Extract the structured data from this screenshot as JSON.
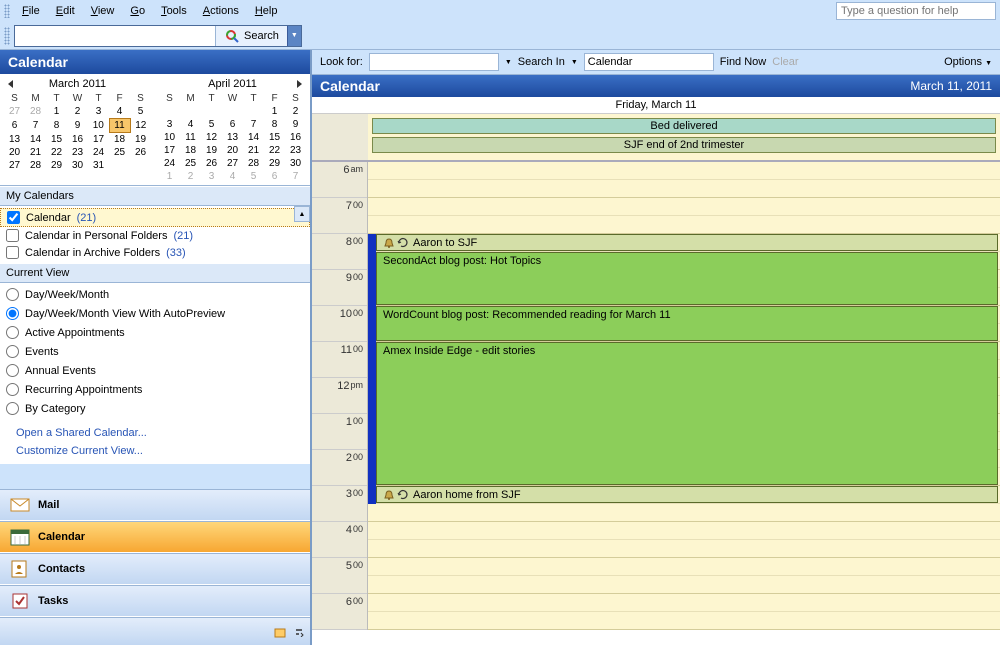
{
  "menu": {
    "file": "File",
    "edit": "Edit",
    "view": "View",
    "go": "Go",
    "tools": "Tools",
    "actions": "Actions",
    "help": "Help"
  },
  "help_placeholder": "Type a question for help",
  "search_button": "Search",
  "sidebar": {
    "title": "Calendar",
    "month1": {
      "label": "March 2011"
    },
    "month2": {
      "label": "April 2011"
    },
    "dow": [
      "S",
      "M",
      "T",
      "W",
      "T",
      "F",
      "S"
    ],
    "mycal_header": "My Calendars",
    "calendars": [
      {
        "label": "Calendar",
        "count": "(21)",
        "checked": true
      },
      {
        "label": "Calendar in Personal Folders",
        "count": "(21)",
        "checked": false
      },
      {
        "label": "Calendar in Archive Folders",
        "count": "(33)",
        "checked": false
      }
    ],
    "currentview_header": "Current View",
    "views": [
      "Day/Week/Month",
      "Day/Week/Month View With AutoPreview",
      "Active Appointments",
      "Events",
      "Annual Events",
      "Recurring Appointments",
      "By Category"
    ],
    "view_selected": 1,
    "links": [
      "Open a Shared Calendar...",
      "Customize Current View..."
    ],
    "nav": {
      "mail": "Mail",
      "calendar": "Calendar",
      "contacts": "Contacts",
      "tasks": "Tasks"
    }
  },
  "lookbar": {
    "lookfor_label": "Look for:",
    "searchin_label": "Search In",
    "searchin_value": "Calendar",
    "findnow": "Find Now",
    "clear": "Clear",
    "options": "Options"
  },
  "calendar": {
    "title": "Calendar",
    "date_long": "March 11, 2011",
    "day_header": "Friday, March 11",
    "allday": [
      "Bed delivered",
      "SJF end of 2nd trimester"
    ],
    "hours": [
      {
        "h": "6",
        "m": "am"
      },
      {
        "h": "7",
        "m": "00"
      },
      {
        "h": "8",
        "m": "00"
      },
      {
        "h": "9",
        "m": "00"
      },
      {
        "h": "10",
        "m": "00"
      },
      {
        "h": "11",
        "m": "00"
      },
      {
        "h": "12",
        "m": "pm"
      },
      {
        "h": "1",
        "m": "00"
      },
      {
        "h": "2",
        "m": "00"
      },
      {
        "h": "3",
        "m": "00"
      },
      {
        "h": "4",
        "m": "00"
      },
      {
        "h": "5",
        "m": "00"
      },
      {
        "h": "6",
        "m": "00"
      }
    ],
    "appts": [
      {
        "label": "Aaron to SJF",
        "start": 2,
        "dur": 0.5,
        "type": "recur",
        "busy": true
      },
      {
        "label": "SecondAct blog post: Hot Topics",
        "start": 2.5,
        "dur": 1.5,
        "type": "green",
        "busy": true
      },
      {
        "label": "WordCount blog post: Recommended reading for March 11",
        "start": 4,
        "dur": 1,
        "type": "green",
        "busy": true
      },
      {
        "label": "Amex Inside Edge - edit stories",
        "start": 5,
        "dur": 4,
        "type": "green",
        "busy": true
      },
      {
        "label": "Aaron home from SJF",
        "start": 9,
        "dur": 0.5,
        "type": "recur",
        "busy": true
      }
    ]
  },
  "march_days": [
    [
      {
        "d": 27,
        "o": 1
      },
      {
        "d": 28,
        "o": 1
      },
      {
        "d": 1
      },
      {
        "d": 2
      },
      {
        "d": 3
      },
      {
        "d": 4
      },
      {
        "d": 5
      }
    ],
    [
      {
        "d": 6
      },
      {
        "d": 7
      },
      {
        "d": 8
      },
      {
        "d": 9
      },
      {
        "d": 10
      },
      {
        "d": 11,
        "t": 1
      },
      {
        "d": 12
      }
    ],
    [
      {
        "d": 13
      },
      {
        "d": 14
      },
      {
        "d": 15
      },
      {
        "d": 16
      },
      {
        "d": 17
      },
      {
        "d": 18
      },
      {
        "d": 19
      }
    ],
    [
      {
        "d": 20
      },
      {
        "d": 21
      },
      {
        "d": 22
      },
      {
        "d": 23
      },
      {
        "d": 24
      },
      {
        "d": 25
      },
      {
        "d": 26
      }
    ],
    [
      {
        "d": 27
      },
      {
        "d": 28
      },
      {
        "d": 29
      },
      {
        "d": 30
      },
      {
        "d": 31
      },
      {
        "d": "",
        "o": 1
      },
      {
        "d": "",
        "o": 1
      }
    ]
  ],
  "april_days": [
    [
      {
        "d": "",
        "o": 1
      },
      {
        "d": "",
        "o": 1
      },
      {
        "d": "",
        "o": 1
      },
      {
        "d": "",
        "o": 1
      },
      {
        "d": "",
        "o": 1
      },
      {
        "d": 1
      },
      {
        "d": 2
      }
    ],
    [
      {
        "d": 3
      },
      {
        "d": 4
      },
      {
        "d": 5
      },
      {
        "d": 6
      },
      {
        "d": 7
      },
      {
        "d": 8
      },
      {
        "d": 9
      }
    ],
    [
      {
        "d": 10
      },
      {
        "d": 11
      },
      {
        "d": 12
      },
      {
        "d": 13
      },
      {
        "d": 14
      },
      {
        "d": 15
      },
      {
        "d": 16
      }
    ],
    [
      {
        "d": 17
      },
      {
        "d": 18
      },
      {
        "d": 19
      },
      {
        "d": 20
      },
      {
        "d": 21
      },
      {
        "d": 22
      },
      {
        "d": 23
      }
    ],
    [
      {
        "d": 24
      },
      {
        "d": 25
      },
      {
        "d": 26
      },
      {
        "d": 27
      },
      {
        "d": 28
      },
      {
        "d": 29
      },
      {
        "d": 30
      }
    ],
    [
      {
        "d": 1,
        "o": 1
      },
      {
        "d": 2,
        "o": 1
      },
      {
        "d": 3,
        "o": 1
      },
      {
        "d": 4,
        "o": 1
      },
      {
        "d": 5,
        "o": 1
      },
      {
        "d": 6,
        "o": 1
      },
      {
        "d": 7,
        "o": 1
      }
    ]
  ]
}
